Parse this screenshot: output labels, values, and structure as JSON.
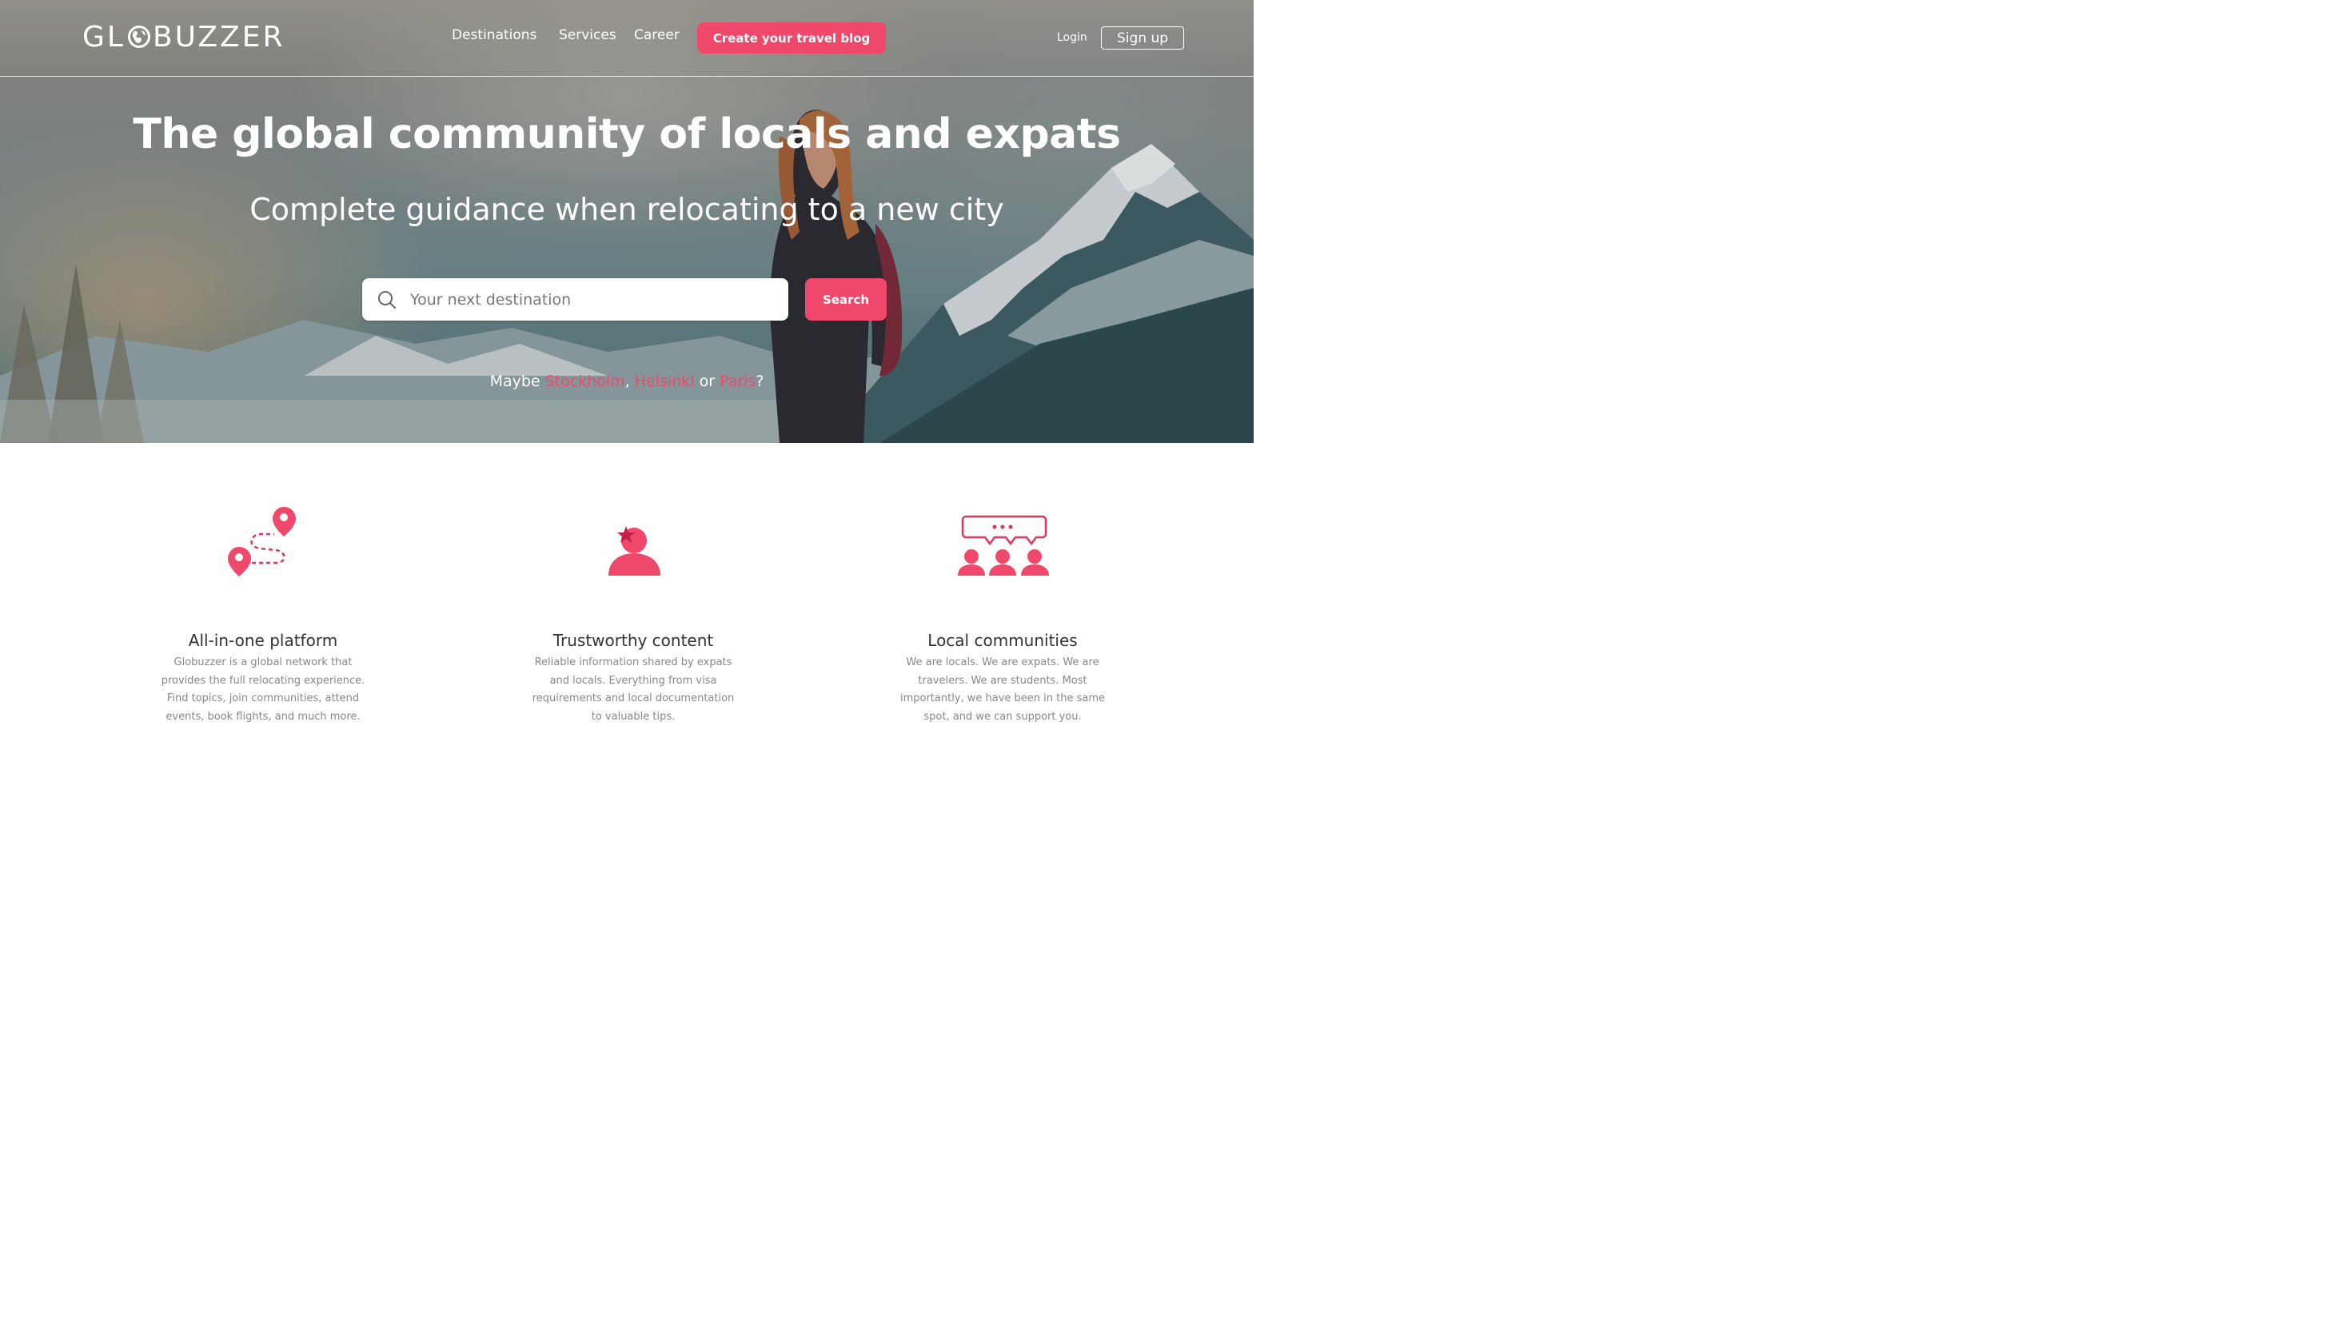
{
  "brand": {
    "name_left": "GL",
    "name_right": "BUZZER"
  },
  "nav": {
    "links": [
      "Destinations",
      "Services",
      "Career"
    ],
    "cta": "Create your travel blog",
    "login": "Login",
    "signup": "Sign up"
  },
  "hero": {
    "title": "The global community of locals and expats",
    "subtitle": "Complete guidance when relocating to a new city",
    "search": {
      "placeholder": "Your next destination",
      "button": "Search"
    },
    "suggest": {
      "prefix": "Maybe ",
      "cities": [
        "Stockholm",
        "Helsinki",
        "Paris"
      ],
      "sep1": ", ",
      "sep2": " or ",
      "suffix": "?"
    }
  },
  "features": [
    {
      "icon": "route-pins-icon",
      "title": "All-in-one platform",
      "text": "Globuzzer is a global network that provides the full relocating experience. Find topics, join communities, attend events, book flights, and much more."
    },
    {
      "icon": "trusted-person-icon",
      "title": "Trustworthy content",
      "text": "Reliable information shared by expats and locals. Everything from visa requirements and local documentation to valuable tips."
    },
    {
      "icon": "community-chat-icon",
      "title": "Local communities",
      "text": "We are locals. We are expats. We are travelers. We are students. Most importantly, we have been in the same spot, and we can support you."
    }
  ],
  "colors": {
    "accent": "#f0486a"
  }
}
